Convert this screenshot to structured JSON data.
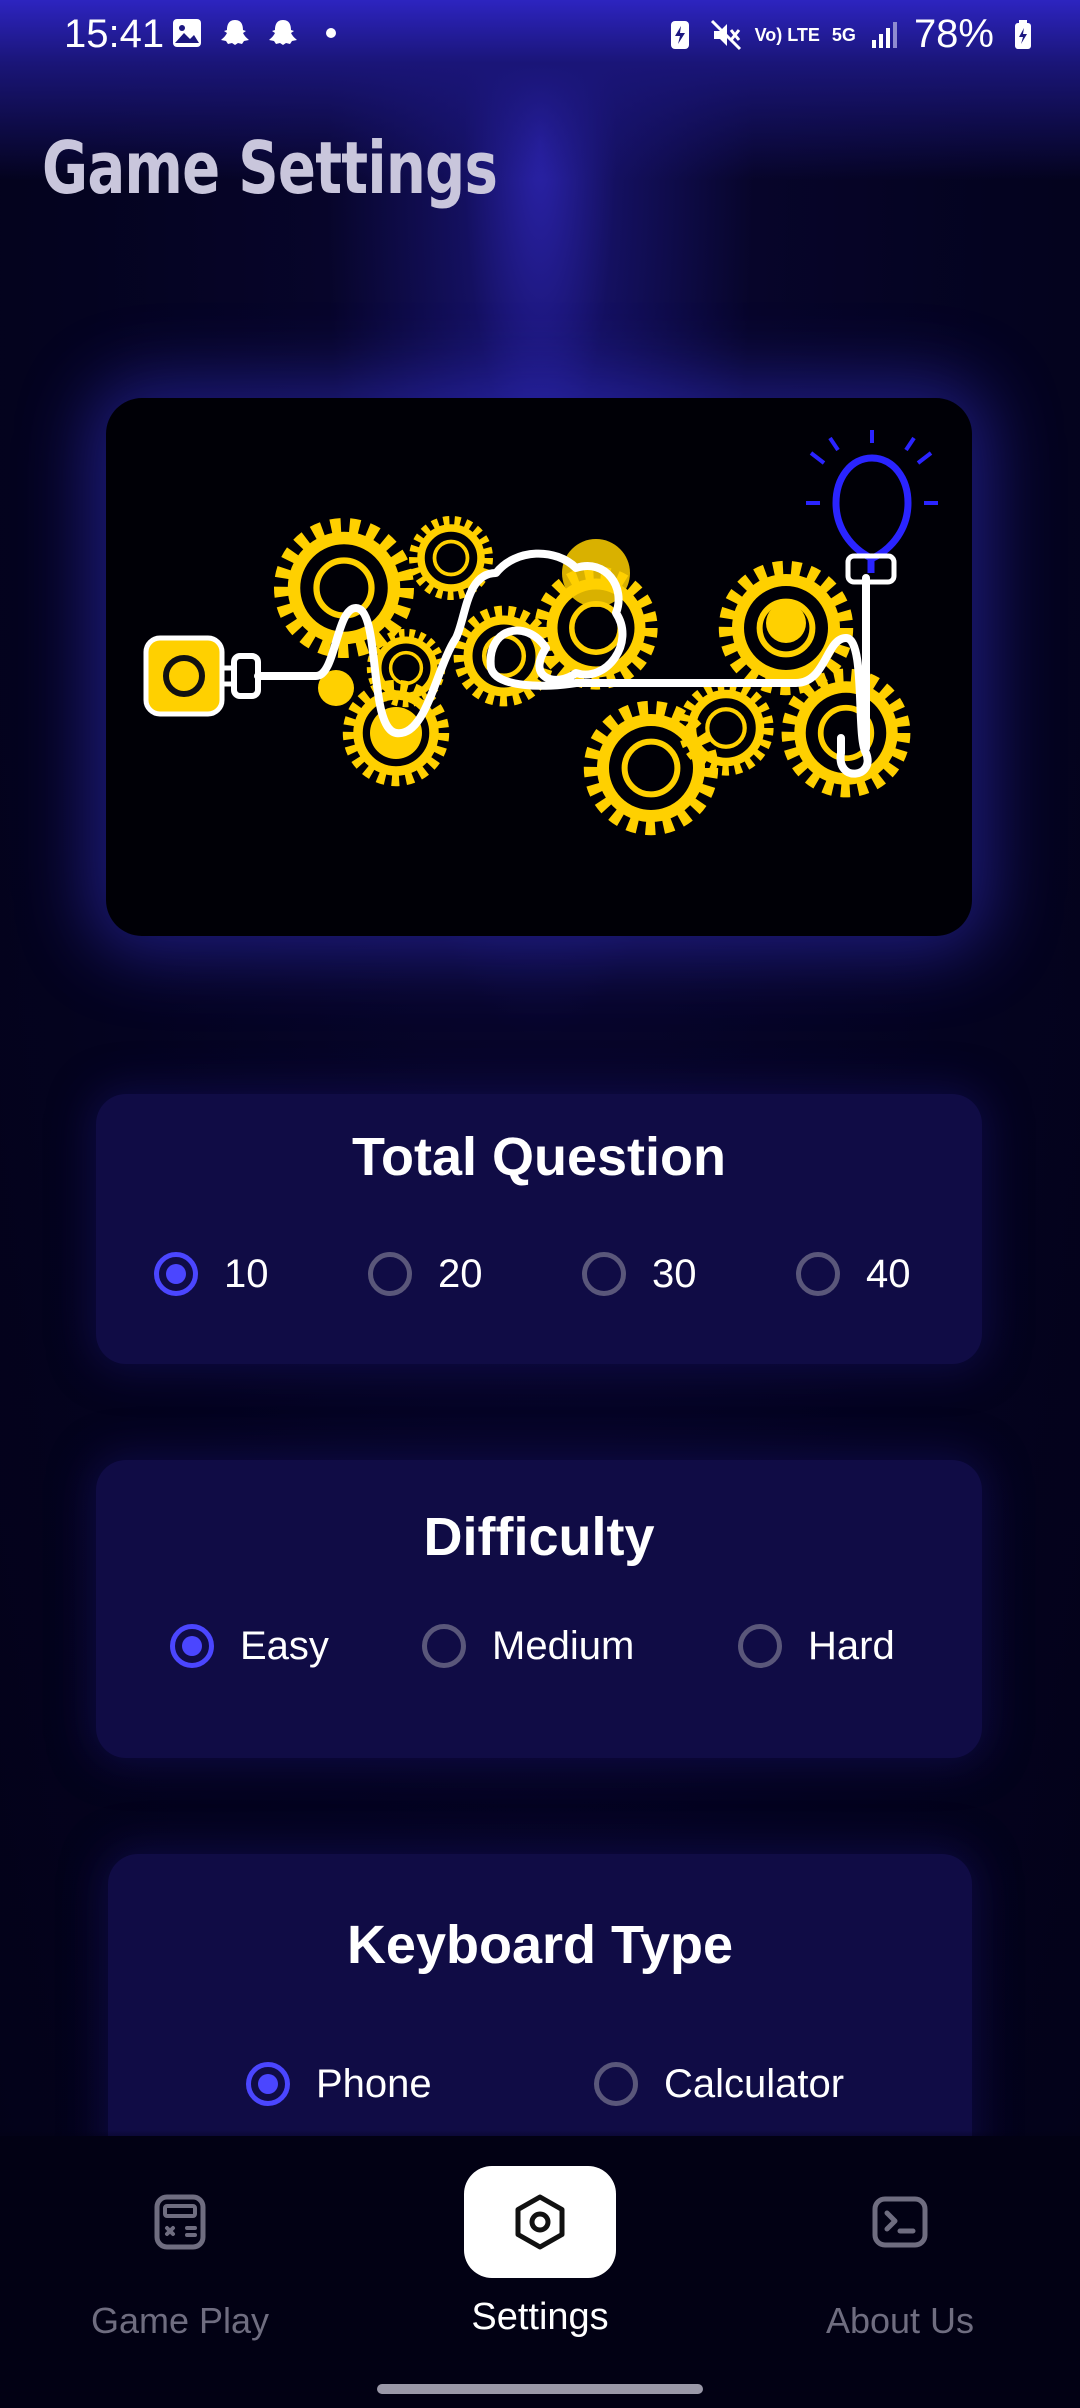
{
  "status_bar": {
    "time": "15:41",
    "network": "5G",
    "volte": "Vo) LTE",
    "battery": "78%"
  },
  "page": {
    "title": "Game Settings"
  },
  "illustration": {
    "icon": "gears-lightbulb-illustration"
  },
  "total_question": {
    "title": "Total Question",
    "options": [
      "10",
      "20",
      "30",
      "40"
    ],
    "selected": "10"
  },
  "difficulty": {
    "title": "Difficulty",
    "options": [
      "Easy",
      "Medium",
      "Hard"
    ],
    "selected": "Easy"
  },
  "keyboard_type": {
    "title": "Keyboard Type",
    "options": [
      "Phone",
      "Calculator"
    ],
    "selected": "Phone"
  },
  "nav": {
    "items": [
      {
        "label": "Game Play",
        "icon": "calculator-icon"
      },
      {
        "label": "Settings",
        "icon": "settings-hexagon-icon"
      },
      {
        "label": "About Us",
        "icon": "terminal-icon"
      }
    ],
    "active": "Settings"
  },
  "colors": {
    "accent": "#4b46ff",
    "card": "#100c45",
    "background": "#040320"
  }
}
